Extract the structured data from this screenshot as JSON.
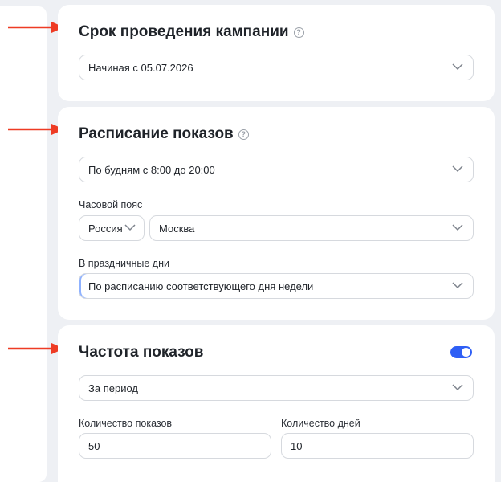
{
  "campaign_period": {
    "title": "Срок проведения кампании",
    "help_icon": "?",
    "select_value": "Начиная с 05.07.2026"
  },
  "schedule": {
    "title": "Расписание показов",
    "help_icon": "?",
    "select_value": "По будням с 8:00 до 20:00",
    "timezone_label": "Часовой пояс",
    "country_value": "Россия",
    "city_value": "Москва",
    "holidays_label": "В праздничные дни",
    "holidays_value": "По расписанию соответствующего дня недели"
  },
  "frequency": {
    "title": "Частота показов",
    "toggle_on": true,
    "period_value": "За период",
    "impressions_label": "Количество показов",
    "impressions_value": "50",
    "days_label": "Количество дней",
    "days_value": "10"
  },
  "colors": {
    "arrow": "#ee3b24",
    "toggle": "#2f5ff5",
    "background": "#eef0f4"
  }
}
